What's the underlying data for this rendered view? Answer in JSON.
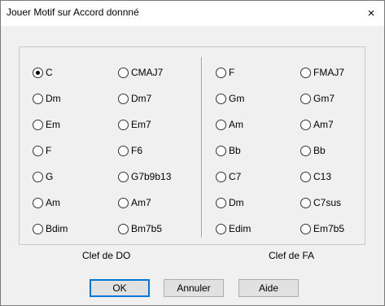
{
  "dialog": {
    "title": "Jouer Motif sur Accord donnné",
    "close_glyph": "×"
  },
  "chords": {
    "col1": [
      "C",
      "Dm",
      "Em",
      "F",
      "G",
      "Am",
      "Bdim"
    ],
    "col2": [
      "CMAJ7",
      "Dm7",
      "Em7",
      "F6",
      "G7b9b13",
      "Am7",
      "Bm7b5"
    ],
    "col3": [
      "F",
      "Gm",
      "Am",
      "Bb",
      "C7",
      "Dm",
      "Edim"
    ],
    "col4": [
      "FMAJ7",
      "Gm7",
      "Am7",
      "Bb",
      "C13",
      "C7sus",
      "Em7b5"
    ],
    "selected": "col1.0"
  },
  "groups": {
    "left": "Clef de DO",
    "right": "Clef de FA"
  },
  "buttons": {
    "ok": "OK",
    "cancel": "Annuler",
    "help": "Aide"
  }
}
